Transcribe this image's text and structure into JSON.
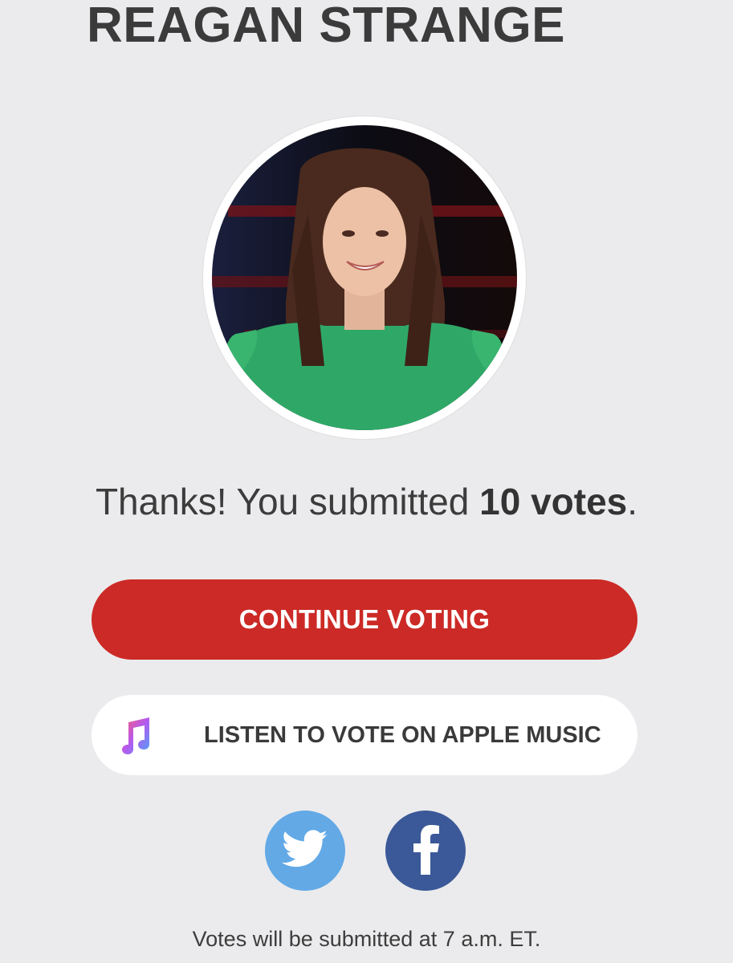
{
  "artist": {
    "name": "REAGAN STRANGE"
  },
  "confirmation": {
    "prefix": "Thanks! You submitted ",
    "votes_text": "10 votes",
    "suffix": "."
  },
  "actions": {
    "continue_label": "CONTINUE VOTING",
    "apple_music_label": "LISTEN TO VOTE ON APPLE MUSIC",
    "apple_music_icon": "music-note-icon"
  },
  "social": {
    "twitter_icon": "twitter-bird-icon",
    "facebook_icon": "facebook-f-icon",
    "twitter_color": "#62a9e6",
    "facebook_color": "#3b5998"
  },
  "colors": {
    "primary_button": "#cc2a26",
    "background": "#ebebed"
  },
  "footer": {
    "note": "Votes will be submitted at 7 a.m. ET."
  }
}
